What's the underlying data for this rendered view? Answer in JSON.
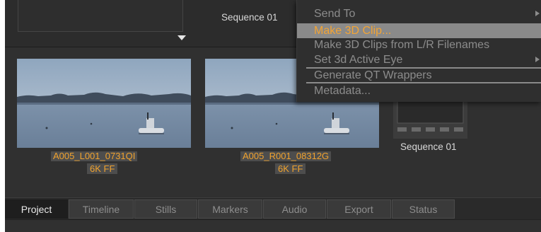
{
  "top_bar": {
    "sequence_label": "Sequence 01"
  },
  "bin": {
    "clips": [
      {
        "name": "A005_L001_0731QI",
        "resolution": "6K FF"
      },
      {
        "name": "A005_R001_08312G",
        "resolution": "6K FF"
      }
    ],
    "sequence": {
      "caption": "Sequence 01"
    }
  },
  "context_menu": {
    "items": [
      {
        "label": "Send To",
        "has_submenu": true,
        "state": "disabled"
      },
      {
        "label": "Make 3D Clip...",
        "has_submenu": false,
        "state": "selected"
      },
      {
        "label": "Make 3D Clips from L/R Filenames",
        "has_submenu": false,
        "state": "disabled"
      },
      {
        "label": "Set 3d Active Eye",
        "has_submenu": true,
        "state": "disabled"
      },
      {
        "label": "Generate QT Wrappers",
        "has_submenu": false,
        "state": "disabled"
      },
      {
        "label": "Metadata...",
        "has_submenu": false,
        "state": "disabled"
      }
    ],
    "highlight_color": "#8a8a8a",
    "selected_text_color": "#f2a435"
  },
  "tabs": [
    {
      "label": "Project",
      "active": true
    },
    {
      "label": "Timeline",
      "active": false
    },
    {
      "label": "Stills",
      "active": false
    },
    {
      "label": "Markers",
      "active": false
    },
    {
      "label": "Audio",
      "active": false
    },
    {
      "label": "Export",
      "active": false
    },
    {
      "label": "Status",
      "active": false
    }
  ],
  "colors": {
    "clip_label_text": "#f0a22e",
    "background": "#2b2b2b"
  }
}
